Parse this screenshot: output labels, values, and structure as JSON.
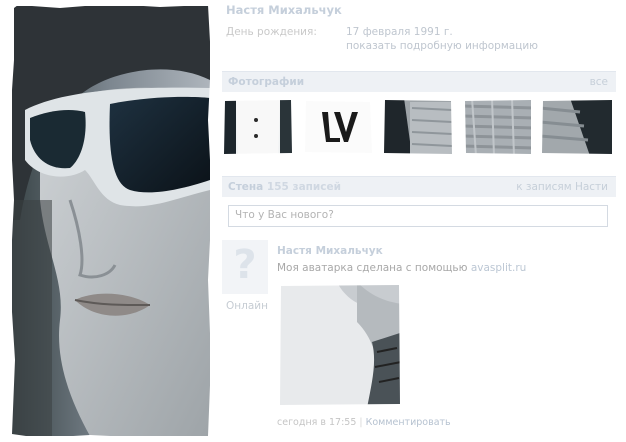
{
  "profile": {
    "name": "Настя Михальчук",
    "birthday_label": "День рождения:",
    "birthday_value": "17 февраля 1991 г.",
    "more_info": "показать подробную информацию"
  },
  "photos": {
    "title": "Фотографии",
    "all_link": "все",
    "thumbnails": [
      "photo-1",
      "photo-2",
      "photo-3",
      "photo-4",
      "photo-5"
    ]
  },
  "wall": {
    "title": "Стена",
    "count": "155 записей",
    "to_wall_link": "к записям Насти",
    "input_placeholder": "Что у Вас нового?"
  },
  "post": {
    "avatar_glyph": "?",
    "online": "Онлайн",
    "author": "Настя Михальчук",
    "text": "Моя аватарка сделана с помощью",
    "link": "avasplit.ru",
    "time": "сегодня в 17:55",
    "separator": "|",
    "comment_link": "Комментировать"
  },
  "colors": {
    "link": "#c5cfdb",
    "section_bg": "#eef1f5"
  }
}
